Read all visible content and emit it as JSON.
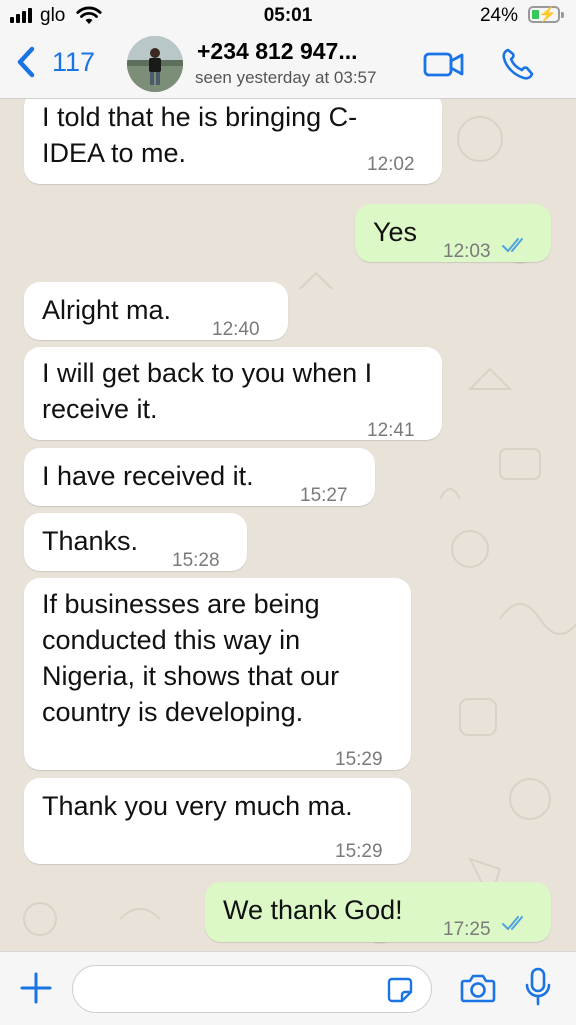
{
  "status_bar": {
    "carrier": "glo",
    "time": "05:01",
    "battery_percent": "24%"
  },
  "header": {
    "back_count": "117",
    "contact_name": "+234 812 947...",
    "last_seen": "seen yesterday at 03:57",
    "icons": [
      "chevron-left-icon",
      "avatar",
      "video-icon",
      "phone-icon"
    ]
  },
  "messages": [
    {
      "direction": "in",
      "text": "I told that he is bringing C-IDEA  to me.",
      "time": "12:02"
    },
    {
      "direction": "out",
      "text": "Yes",
      "time": "12:03",
      "status": "read"
    },
    {
      "direction": "in",
      "text": "Alright ma.",
      "time": "12:40"
    },
    {
      "direction": "in",
      "text": "I will get back to you when I receive it.",
      "time": "12:41"
    },
    {
      "direction": "in",
      "text": "I have received it.",
      "time": "15:27"
    },
    {
      "direction": "in",
      "text": "Thanks.",
      "time": "15:28"
    },
    {
      "direction": "in",
      "text": "If businesses are being conducted this way in Nigeria, it shows that our country is developing.",
      "time": "15:29"
    },
    {
      "direction": "in",
      "text": "Thank you very much ma.",
      "time": "15:29"
    },
    {
      "direction": "out",
      "text": "We thank God!",
      "time": "17:25",
      "status": "read"
    }
  ],
  "input_bar": {
    "placeholder": "",
    "icons": [
      "plus-icon",
      "sticker-icon",
      "camera-icon",
      "microphone-icon"
    ]
  },
  "colors": {
    "accent": "#1b74e4",
    "incoming_bubble": "#ffffff",
    "outgoing_bubble": "#dcf8c6",
    "read_ticks": "#4fa3e0",
    "wallpaper": "#e8e2d8"
  }
}
